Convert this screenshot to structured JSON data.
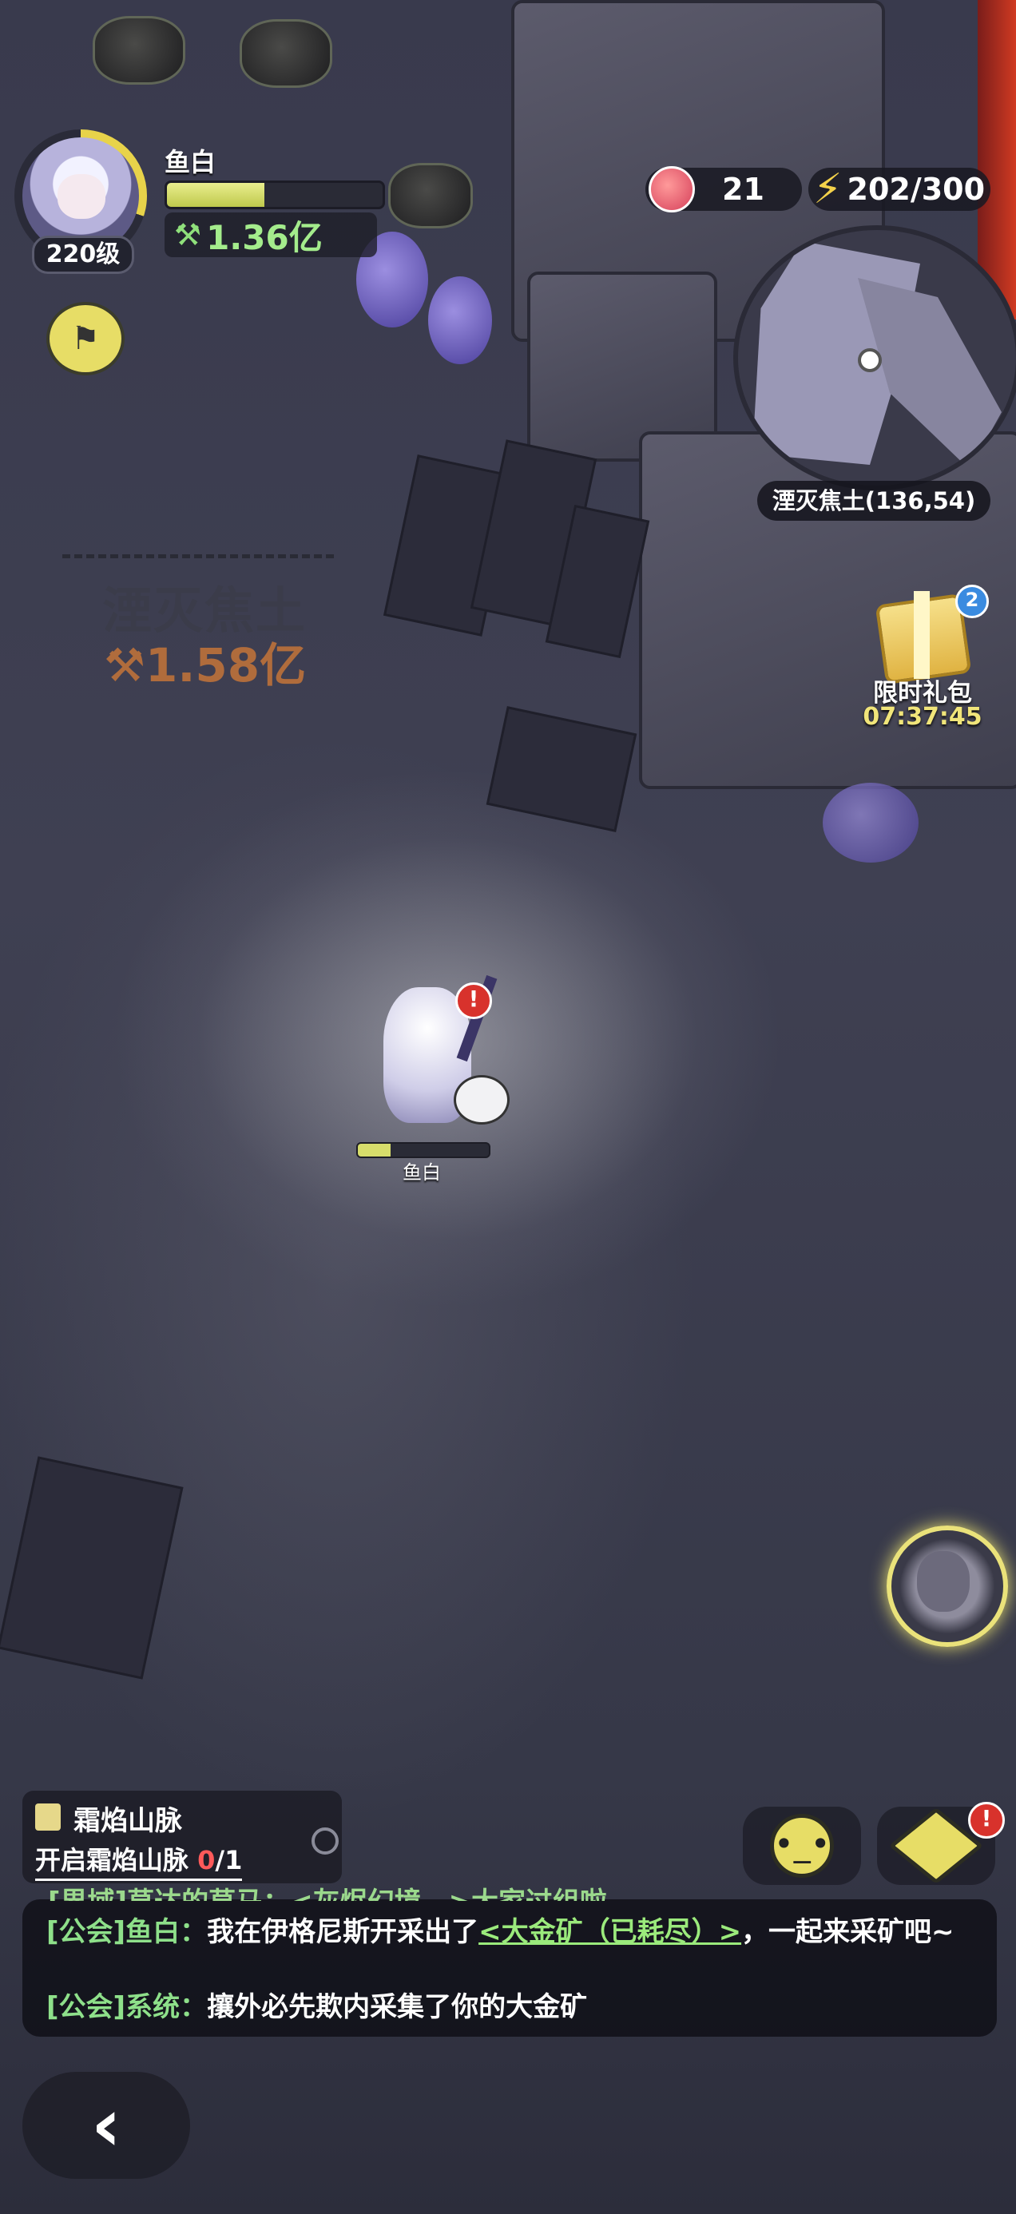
{
  "player": {
    "name": "鱼白",
    "level": "220级",
    "power": "1.36亿",
    "hp_fraction": 0.45
  },
  "resources": {
    "apples": "21",
    "energy": "202/300"
  },
  "minimap": {
    "location": "湮灭焦土(136,54)"
  },
  "gift": {
    "badge": "2",
    "label": "限时礼包",
    "timer": "07:37:45"
  },
  "zone": {
    "name": "湮灭焦土",
    "power": "1.58亿"
  },
  "character": {
    "name": "鱼白",
    "hp_fraction": 0.25,
    "alert": "!"
  },
  "quest": {
    "title": "霜焰山脉",
    "desc_prefix": "开启霜焰山脉 ",
    "progress_current": "0",
    "progress_total": "/1"
  },
  "buttons": {
    "bag_alert": "!"
  },
  "chat": {
    "cutoff_line": "[界域]草达的草马：<灰烬幻境…>大家过组啦",
    "line1": {
      "channel": "[公会]",
      "sender": "鱼白：",
      "text_before": "我在伊格尼斯开采出了",
      "link": "<大金矿（已耗尽）>",
      "text_after": "，一起来采矿吧~"
    },
    "line2": {
      "channel": "[公会]",
      "sender": "系统：",
      "text": "攘外必先欺内采集了你的大金矿"
    }
  },
  "icons": {
    "power": "crossed-pickaxe-icon",
    "energy": "lightning-bolt-icon",
    "apple": "apple-icon",
    "guild": "guild-flag-icon",
    "back": "chevron-left-icon",
    "emoji": "emoji-face-icon",
    "bag": "cube-bag-icon",
    "quest": "clipboard-icon",
    "target": "target-icon"
  }
}
